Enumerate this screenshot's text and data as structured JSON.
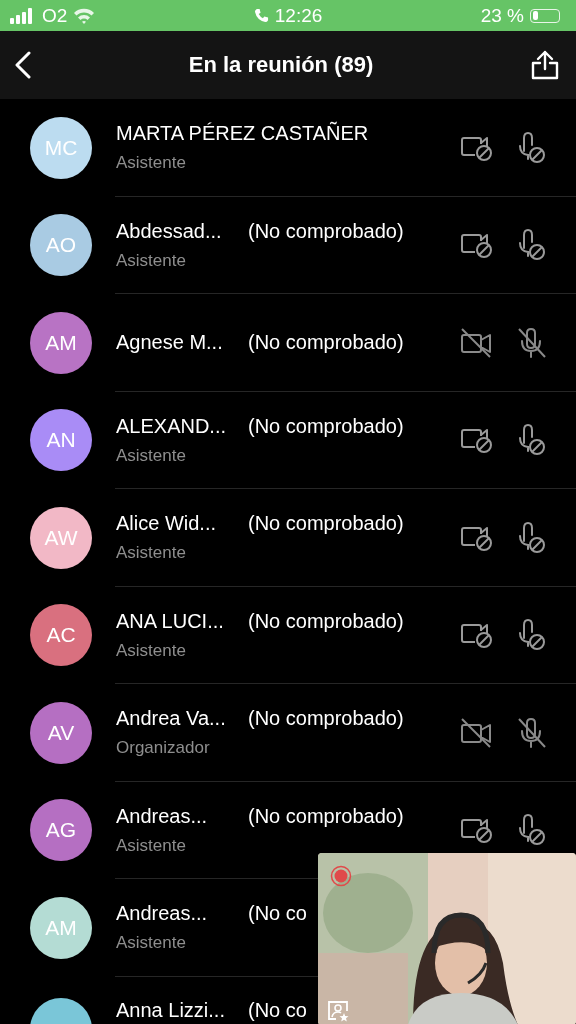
{
  "status_bar": {
    "carrier": "O2",
    "time": "12:26",
    "battery": "23 %"
  },
  "header": {
    "title": "En la reunión (89)"
  },
  "participants": [
    {
      "initials": "MC",
      "color": "#bcdcf0",
      "name": "MARTA PÉREZ CASTAÑER",
      "role": "Asistente",
      "kind": "blocked"
    },
    {
      "initials": "AO",
      "color": "#a9cbe3",
      "name": "Abdessad...",
      "tag": "(No comprobado)",
      "role": "Asistente",
      "kind": "blocked"
    },
    {
      "initials": "AM",
      "color": "#b873c4",
      "name": "Agnese M...",
      "tag": "(No comprobado)",
      "kind": "off"
    },
    {
      "initials": "AN",
      "color": "#a98cf6",
      "name": "ALEXAND...",
      "tag": "(No comprobado)",
      "role": "Asistente",
      "kind": "blocked"
    },
    {
      "initials": "AW",
      "color": "#f2b8c6",
      "name": "Alice Wid...",
      "tag": "(No comprobado)",
      "role": "Asistente",
      "kind": "blocked"
    },
    {
      "initials": "AC",
      "color": "#d9707f",
      "name": "ANA LUCI...",
      "tag": "(No comprobado)",
      "role": "Asistente",
      "kind": "blocked"
    },
    {
      "initials": "AV",
      "color": "#b56fc2",
      "name": "Andrea Va...",
      "tag": "(No comprobado)",
      "role": "Organizador",
      "kind": "off"
    },
    {
      "initials": "AG",
      "color": "#b56fc2",
      "name": "Andreas...",
      "tag": "(No comprobado)",
      "role": "Asistente",
      "kind": "blocked"
    },
    {
      "initials": "AM",
      "color": "#b4dcd4",
      "name": "Andreas...",
      "tag": "(No co",
      "role": "Asistente"
    },
    {
      "color": "#7ac6d8",
      "name": "Anna Lizzi...",
      "tag": "(No co"
    }
  ],
  "self_view": {
    "kind": "picture",
    "recording": true
  }
}
